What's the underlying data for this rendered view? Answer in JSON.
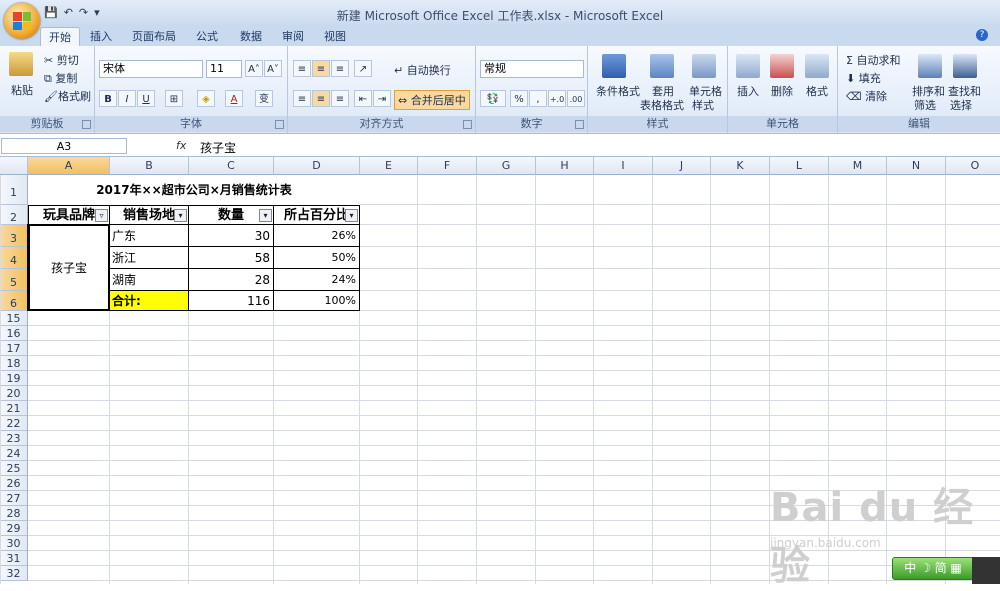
{
  "window": {
    "title": "新建 Microsoft Office Excel 工作表.xlsx - Microsoft Excel"
  },
  "quick_access": {
    "save": "💾",
    "undo": "↶",
    "redo": "↷",
    "customize": "▾"
  },
  "tabs": [
    "开始",
    "插入",
    "页面布局",
    "公式",
    "数据",
    "审阅",
    "视图"
  ],
  "ribbon": {
    "clipboard": {
      "label": "剪贴板",
      "paste": "粘贴",
      "cut": "剪切",
      "copy": "复制",
      "format_painter": "格式刷"
    },
    "font": {
      "label": "字体",
      "font_name": "宋体",
      "font_size": "11",
      "grow": "A˄",
      "shrink": "A˅",
      "bold": "B",
      "italic": "I",
      "underline": "U",
      "border": "⊞",
      "fill": "◈",
      "font_color": "A",
      "phonetic": "变"
    },
    "alignment": {
      "label": "对齐方式",
      "wrap_text": "自动换行",
      "merge_center": "合并后居中"
    },
    "number": {
      "label": "数字",
      "format": "常规",
      "currency": "💱",
      "percent": "%",
      "comma": ",",
      "inc_decimal": "+.0",
      "dec_decimal": ".00"
    },
    "styles": {
      "label": "样式",
      "conditional": "条件格式",
      "table_format_1": "套用",
      "table_format_2": "表格格式",
      "cell_styles_1": "单元格",
      "cell_styles_2": "样式"
    },
    "cells": {
      "label": "单元格",
      "insert": "插入",
      "delete": "删除",
      "format": "格式"
    },
    "editing": {
      "label": "编辑",
      "autosum": "自动求和",
      "fill": "填充",
      "clear": "清除",
      "sort_filter_1": "排序和",
      "sort_filter_2": "筛选",
      "find_1": "查找和",
      "find_2": "选择"
    }
  },
  "formula_bar": {
    "name_box": "A3",
    "fx": "fx",
    "value": "孩子宝"
  },
  "columns": [
    "A",
    "B",
    "C",
    "D",
    "E",
    "F",
    "G",
    "H",
    "I",
    "J",
    "K",
    "L",
    "M",
    "N",
    "O"
  ],
  "rows": [
    "1",
    "2",
    "3",
    "4",
    "5",
    "6",
    "15",
    "16",
    "17",
    "18",
    "19",
    "20",
    "21",
    "22",
    "23",
    "24",
    "25",
    "26",
    "27",
    "28",
    "29",
    "30",
    "31",
    "32"
  ],
  "sheet": {
    "title": "2017年××超市公司×月销售统计表",
    "headers": [
      "玩具品牌",
      "销售场地",
      "数量",
      "所占百分比"
    ],
    "brand": "孩子宝",
    "data": [
      {
        "place": "广东",
        "qty": "30",
        "pct": "26%"
      },
      {
        "place": "浙江",
        "qty": "58",
        "pct": "50%"
      },
      {
        "place": "湖南",
        "qty": "28",
        "pct": "24%"
      }
    ],
    "total_label": "合计:",
    "total_qty": "116",
    "total_pct": "100%",
    "total_fill": "#ffff00"
  },
  "watermark": {
    "main": "Bai du 经验",
    "sub": "jingyan.baidu.com"
  },
  "ime": {
    "label": "中 ☽ 简 ▦"
  },
  "colors": {
    "accent": "#c9d9ee",
    "selection": "#f1c15f"
  }
}
